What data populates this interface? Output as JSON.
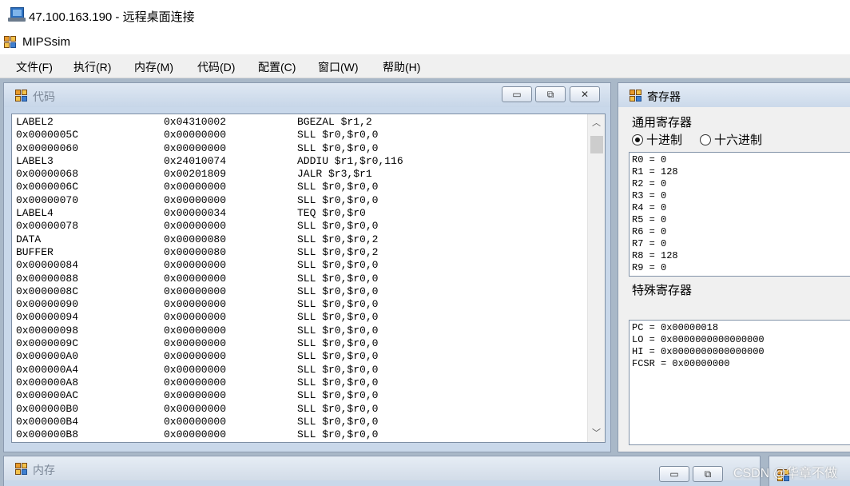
{
  "rdp": {
    "title": "47.100.163.190 - 远程桌面连接",
    "icon": "remote-desktop-icon"
  },
  "app": {
    "title": "MIPSsim",
    "icon": "mipssim-app-icon"
  },
  "menu": [
    {
      "label": "文件(F)"
    },
    {
      "label": "执行(R)"
    },
    {
      "label": "内存(M)"
    },
    {
      "label": "代码(D)"
    },
    {
      "label": "配置(C)"
    },
    {
      "label": "窗口(W)"
    },
    {
      "label": "帮助(H)"
    }
  ],
  "code_window": {
    "title": "代码",
    "buttons": {
      "minimize": "▭",
      "restore": "⧉",
      "close": "✕"
    },
    "rows": [
      [
        "LABEL2",
        "0x04310002",
        "BGEZAL $r1,2"
      ],
      [
        "0x0000005C",
        "0x00000000",
        "SLL $r0,$r0,0"
      ],
      [
        "0x00000060",
        "0x00000000",
        "SLL $r0,$r0,0"
      ],
      [
        "LABEL3",
        "0x24010074",
        "ADDIU $r1,$r0,116"
      ],
      [
        "0x00000068",
        "0x00201809",
        "JALR $r3,$r1"
      ],
      [
        "0x0000006C",
        "0x00000000",
        "SLL $r0,$r0,0"
      ],
      [
        "0x00000070",
        "0x00000000",
        "SLL $r0,$r0,0"
      ],
      [
        "LABEL4",
        "0x00000034",
        "TEQ $r0,$r0"
      ],
      [
        "0x00000078",
        "0x00000000",
        "SLL $r0,$r0,0"
      ],
      [
        "DATA",
        "0x00000080",
        "SLL $r0,$r0,2"
      ],
      [
        "BUFFER",
        "0x00000080",
        "SLL $r0,$r0,2"
      ],
      [
        "0x00000084",
        "0x00000000",
        "SLL $r0,$r0,0"
      ],
      [
        "0x00000088",
        "0x00000000",
        "SLL $r0,$r0,0"
      ],
      [
        "0x0000008C",
        "0x00000000",
        "SLL $r0,$r0,0"
      ],
      [
        "0x00000090",
        "0x00000000",
        "SLL $r0,$r0,0"
      ],
      [
        "0x00000094",
        "0x00000000",
        "SLL $r0,$r0,0"
      ],
      [
        "0x00000098",
        "0x00000000",
        "SLL $r0,$r0,0"
      ],
      [
        "0x0000009C",
        "0x00000000",
        "SLL $r0,$r0,0"
      ],
      [
        "0x000000A0",
        "0x00000000",
        "SLL $r0,$r0,0"
      ],
      [
        "0x000000A4",
        "0x00000000",
        "SLL $r0,$r0,0"
      ],
      [
        "0x000000A8",
        "0x00000000",
        "SLL $r0,$r0,0"
      ],
      [
        "0x000000AC",
        "0x00000000",
        "SLL $r0,$r0,0"
      ],
      [
        "0x000000B0",
        "0x00000000",
        "SLL $r0,$r0,0"
      ],
      [
        "0x000000B4",
        "0x00000000",
        "SLL $r0,$r0,0"
      ],
      [
        "0x000000B8",
        "0x00000000",
        "SLL $r0,$r0,0"
      ]
    ]
  },
  "registers_window": {
    "title": "寄存器",
    "general_label": "通用寄存器",
    "radio_decimal": "十进制",
    "radio_hex": "十六进制",
    "radio_selected": "decimal",
    "general": [
      "R0 = 0",
      "R1 = 128",
      "R2 = 0",
      "R3 = 0",
      "R4 = 0",
      "R5 = 0",
      "R6 = 0",
      "R7 = 0",
      "R8 = 128",
      "R9 = 0"
    ],
    "special_label": "特殊寄存器",
    "special": [
      "PC = 0x00000018",
      "LO = 0x0000000000000000",
      "HI = 0x0000000000000000",
      "FCSR = 0x00000000"
    ]
  },
  "memory_window": {
    "title": "内存"
  },
  "watermark": "CSDN @华章不做"
}
